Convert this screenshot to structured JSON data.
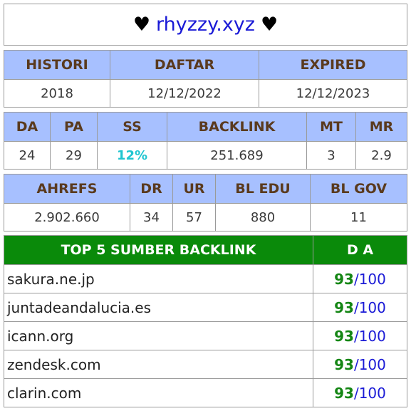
{
  "site": {
    "title": "rhyzzy.xyz",
    "heart": "♥"
  },
  "info": {
    "headers": [
      "HISTORI",
      "DAFTAR",
      "EXPIRED"
    ],
    "values": [
      "2018",
      "12/12/2022",
      "12/12/2023"
    ]
  },
  "metrics": {
    "headers": [
      "DA",
      "PA",
      "SS",
      "BACKLINK",
      "MT",
      "MR"
    ],
    "values": [
      "24",
      "29",
      "12%",
      "251.689",
      "3",
      "2.9"
    ]
  },
  "ahrefs": {
    "headers": [
      "AHREFS",
      "DR",
      "UR",
      "BL EDU",
      "BL GOV"
    ],
    "values": [
      "2.902.660",
      "34",
      "57",
      "880",
      "11"
    ]
  },
  "top": {
    "header_source": "TOP 5 SUMBER BACKLINK",
    "header_da": "D A",
    "rows": [
      {
        "source": "sakura.ne.jp",
        "da": "93",
        "max": "/100"
      },
      {
        "source": "juntadeandalucia.es",
        "da": "93",
        "max": "/100"
      },
      {
        "source": "icann.org",
        "da": "93",
        "max": "/100"
      },
      {
        "source": "zendesk.com",
        "da": "93",
        "max": "/100"
      },
      {
        "source": "clarin.com",
        "da": "93",
        "max": "/100"
      }
    ]
  },
  "colors": {
    "header_bg": "#a7c0ff",
    "top_header_bg": "#0a8a0a",
    "link_blue": "#1a1ad6",
    "ss_cyan": "#1fc5d0",
    "da_green": "#148614"
  }
}
